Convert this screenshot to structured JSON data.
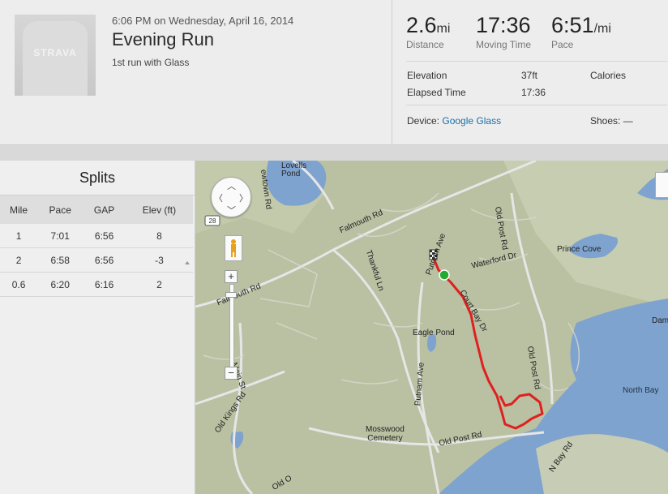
{
  "activity": {
    "datetime": "6:06 PM on Wednesday, April 16, 2014",
    "title": "Evening Run",
    "description": "1st run with Glass",
    "avatar_logo": "STRAVA"
  },
  "stats": {
    "distance": {
      "value": "2.6",
      "unit": "mi",
      "label": "Distance"
    },
    "moving_time": {
      "value": "17:36",
      "label": "Moving Time"
    },
    "pace": {
      "value": "6:51",
      "unit": "/mi",
      "label": "Pace"
    },
    "elevation": {
      "label": "Elevation",
      "value": "37ft"
    },
    "calories": {
      "label": "Calories"
    },
    "elapsed": {
      "label": "Elapsed Time",
      "value": "17:36"
    },
    "device": {
      "label": "Device:",
      "value": "Google Glass"
    },
    "shoes": {
      "label": "Shoes:",
      "value": "—"
    }
  },
  "splits": {
    "title": "Splits",
    "columns": [
      "Mile",
      "Pace",
      "GAP",
      "Elev (ft)"
    ],
    "rows": [
      [
        "1",
        "7:01",
        "6:56",
        "8"
      ],
      [
        "2",
        "6:58",
        "6:56",
        "-3"
      ],
      [
        "0.6",
        "6:20",
        "6:16",
        "2"
      ]
    ]
  },
  "map": {
    "labels": {
      "lovells_pond": "Lovells\nPond",
      "falmouth_rd_1": "Falmouth Rd",
      "falmouth_rd_2": "Falmouth Rd",
      "route_28": "28",
      "thankful_ln": "Thankful Ln",
      "putnam_ave_1": "Putnam Ave",
      "putnam_ave_2": "Putnam Ave",
      "waterford_dr": "Waterford Dr",
      "court_bay_dr": "Court Bay Dr",
      "old_post_rd_1": "Old Post Rd",
      "old_post_rd_2": "Old Post Rd",
      "old_post_rd_3": "Old Post Rd",
      "prince_cove": "Prince Cove",
      "eagle_pond": "Eagle Pond",
      "north_bay": "North Bay",
      "dam": "Dam",
      "main_st": "Main St",
      "old_kings_rd": "Old Kings Rd",
      "mosswood_cemetery": "Mosswood\nCemetery",
      "n_bay_rd": "N Bay Rd",
      "ewtown_rd": "ewtown Rd",
      "old_o": "Old O"
    },
    "colors": {
      "route": "#e02020",
      "water": "#7fa3cf",
      "land": "#b9c1a2",
      "start": "#22aa33"
    }
  },
  "colors": {
    "link": "#1a6fa8"
  }
}
